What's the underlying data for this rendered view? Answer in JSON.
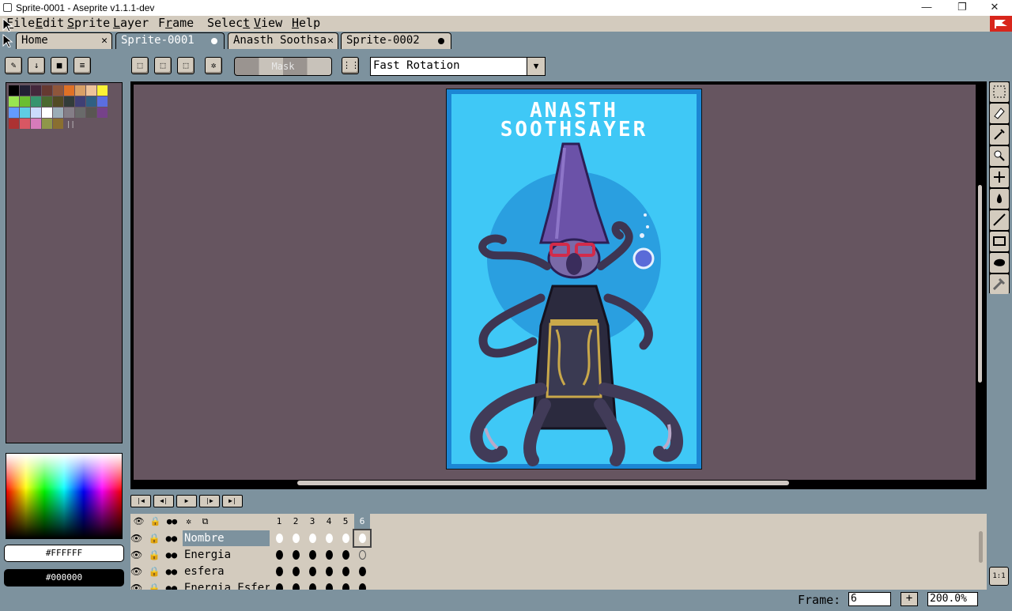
{
  "window": {
    "title": "Sprite-0001 - Aseprite v1.1.1-dev",
    "minimize": "—",
    "restore": "❐",
    "close": "✕"
  },
  "menu": {
    "items": [
      {
        "pre": "",
        "ul": "F",
        "post": "ile"
      },
      {
        "pre": "",
        "ul": "E",
        "post": "dit"
      },
      {
        "pre": "",
        "ul": "S",
        "post": "prite"
      },
      {
        "pre": "",
        "ul": "L",
        "post": "ayer"
      },
      {
        "pre": "F",
        "ul": "r",
        "post": "ame"
      },
      {
        "pre": "Selec",
        "ul": "t",
        "post": ""
      },
      {
        "pre": "",
        "ul": "V",
        "post": "iew"
      },
      {
        "pre": "",
        "ul": "H",
        "post": "elp"
      }
    ]
  },
  "tabs": [
    {
      "label": "Home",
      "marker": "close"
    },
    {
      "label": "Sprite-0001",
      "marker": "dot",
      "active": true
    },
    {
      "label": "Anasth Soothsa",
      "marker": "close"
    },
    {
      "label": "Sprite-0002",
      "marker": "dot"
    }
  ],
  "toolbar": {
    "mask_label": "Mask",
    "rotation_algorithm": "Fast Rotation",
    "combo_arrow": "▼"
  },
  "palette": {
    "colors": [
      "#000000",
      "#222034",
      "#45283c",
      "#663931",
      "#8f563b",
      "#df7126",
      "#d9a066",
      "#eec39a",
      "#fbf236",
      "#99e550",
      "#6abe30",
      "#37946e",
      "#4b692f",
      "#524b24",
      "#323c39",
      "#3f3f74",
      "#306082",
      "#5b6ee1",
      "#639bff",
      "#5fcde4",
      "#cbdbfc",
      "#ffffff",
      "#9badb7",
      "#847e87",
      "#696a6a",
      "#595652",
      "#76428a",
      "#ac3232",
      "#d95763",
      "#d77bba",
      "#8f974a",
      "#8a6f30"
    ]
  },
  "colors": {
    "foreground": "#FFFFFF",
    "background": "#000000"
  },
  "sprite": {
    "title_line1": "ANASTH",
    "title_line2": "SOOTHSAYER"
  },
  "playback": [
    "|◀",
    "◀|",
    "▶",
    "|▶",
    "▶|"
  ],
  "timeline": {
    "header_icons": [
      "👁",
      "🔒",
      "●●",
      "✲",
      "⧉"
    ],
    "frames": [
      "1",
      "2",
      "3",
      "4",
      "5",
      "6"
    ],
    "current_frame": 6,
    "layers": [
      {
        "name": "Nombre",
        "selected": true,
        "cels": [
          1,
          1,
          1,
          1,
          1,
          1
        ]
      },
      {
        "name": "Energia",
        "selected": false,
        "cels": [
          1,
          1,
          1,
          1,
          1,
          0
        ]
      },
      {
        "name": "esfera",
        "selected": false,
        "cels": [
          1,
          1,
          1,
          1,
          1,
          1
        ]
      },
      {
        "name": "Energia Esfera",
        "selected": false,
        "cels": [
          1,
          1,
          1,
          1,
          1,
          1
        ]
      }
    ]
  },
  "status": {
    "frame_label": "Frame:",
    "frame_value": "6",
    "plus": "+",
    "zoom": "200.0%"
  },
  "onion_label": "1:1"
}
